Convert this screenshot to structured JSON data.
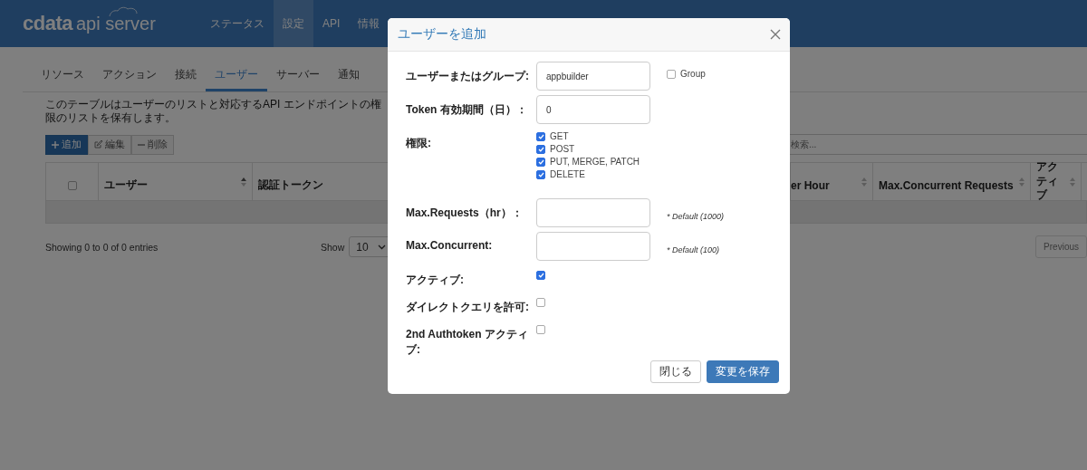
{
  "header": {
    "logo": {
      "brand": "cdata",
      "product": "api server"
    },
    "nav": [
      {
        "label": "ステータス",
        "selected": false
      },
      {
        "label": "設定",
        "selected": true
      },
      {
        "label": "API",
        "selected": false
      },
      {
        "label": "情報",
        "selected": false
      }
    ]
  },
  "tabs": [
    {
      "label": "リソース",
      "selected": false
    },
    {
      "label": "アクション",
      "selected": false
    },
    {
      "label": "接続",
      "selected": false
    },
    {
      "label": "ユーザー",
      "selected": true
    },
    {
      "label": "サーバー",
      "selected": false
    },
    {
      "label": "通知",
      "selected": false
    }
  ],
  "description": "このテーブルはユーザーのリストと対応するAPI エンドポイントの権限のリストを保有します。",
  "toolbar": [
    {
      "kind": "add",
      "label": "追加",
      "disabled": false
    },
    {
      "kind": "edit",
      "label": "編集",
      "disabled": true
    },
    {
      "kind": "delete",
      "label": "削除",
      "disabled": true
    }
  ],
  "search": {
    "placeholder": "検索..."
  },
  "table": {
    "select_all": {
      "checked": false
    },
    "columns": [
      {
        "label": "ユーザー"
      },
      {
        "label": "認証トークン"
      },
      {
        "label": "er Hour"
      },
      {
        "label": "Max.Concurrent Requests"
      },
      {
        "label": "アクティブ"
      }
    ]
  },
  "footer": {
    "info": "Showing 0 to 0 of 0 entries",
    "show_label": "Show",
    "page_size": "10",
    "previous": "Previous"
  },
  "dialog": {
    "title": "ユーザーを追加",
    "rows": [
      {
        "kind": "input",
        "label": "ユーザーまたはグループ:",
        "value": "appbuilder",
        "option": {
          "label": "Group",
          "checked": false
        }
      },
      {
        "kind": "input",
        "label": "Token 有効期間（日）：",
        "value": "0"
      },
      {
        "kind": "checks",
        "label": "権限:",
        "options": [
          {
            "label": "GET",
            "checked": true
          },
          {
            "label": "POST",
            "checked": true
          },
          {
            "label": "PUT, MERGE, PATCH",
            "checked": true
          },
          {
            "label": "DELETE",
            "checked": true
          }
        ]
      },
      {
        "kind": "input",
        "label": "Max.Requests（hr）：",
        "note": "* Default (1000)"
      },
      {
        "kind": "input",
        "label": "Max.Concurrent:",
        "note": "* Default (100)"
      },
      {
        "kind": "checkbox",
        "label": "アクティブ:",
        "checked": true
      },
      {
        "kind": "checkbox",
        "label": "ダイレクトクエリを許可:",
        "checked": false
      },
      {
        "kind": "checkbox",
        "label": "2nd Authtoken アクティブ:",
        "checked": false
      }
    ],
    "buttons": [
      {
        "kind": "secondary",
        "label": "閉じる"
      },
      {
        "kind": "primary",
        "label": "変更を保存"
      }
    ]
  }
}
